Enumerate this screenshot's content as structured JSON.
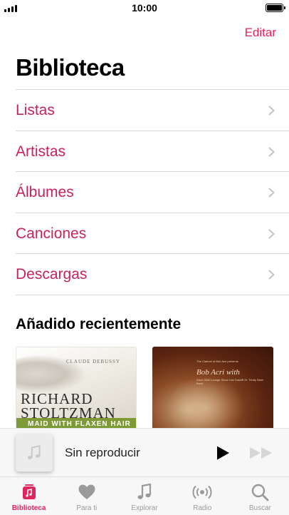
{
  "status_bar": {
    "time": "10:00",
    "signal_bars": 4,
    "battery_level": 1.0
  },
  "header": {
    "edit_label": "Editar",
    "title": "Biblioteca"
  },
  "library_items": [
    {
      "label": "Listas"
    },
    {
      "label": "Artistas"
    },
    {
      "label": "Álbumes"
    },
    {
      "label": "Canciones"
    },
    {
      "label": "Descargas"
    }
  ],
  "recently_added": {
    "title": "Añadido recientemente",
    "albums": [
      {
        "top_label": "CLAUDE DEBUSSY",
        "artist_line1": "RICHARD",
        "artist_line2": "STOLTZMAN",
        "band": "MAID WITH FLAXEN HAIR"
      },
      {
        "small_text": "The Clarinet of Bob Acri presents",
        "name": "Bob Acri with",
        "sub_text": "Dave Gibb Lounge Show Live Sutcliff St. Trinity Steel Band"
      }
    ]
  },
  "player": {
    "now_playing": "Sin reproducir"
  },
  "tabs": [
    {
      "label": "Biblioteca",
      "icon": "library-icon",
      "active": true
    },
    {
      "label": "Para ti",
      "icon": "heart-icon",
      "active": false
    },
    {
      "label": "Explorar",
      "icon": "music-note-icon",
      "active": false
    },
    {
      "label": "Radio",
      "icon": "radio-icon",
      "active": false
    },
    {
      "label": "Buscar",
      "icon": "search-icon",
      "active": false
    }
  ],
  "colors": {
    "accent": "#e0245e",
    "list_text": "#c7225f",
    "inactive_tab": "#9a9a9a"
  }
}
